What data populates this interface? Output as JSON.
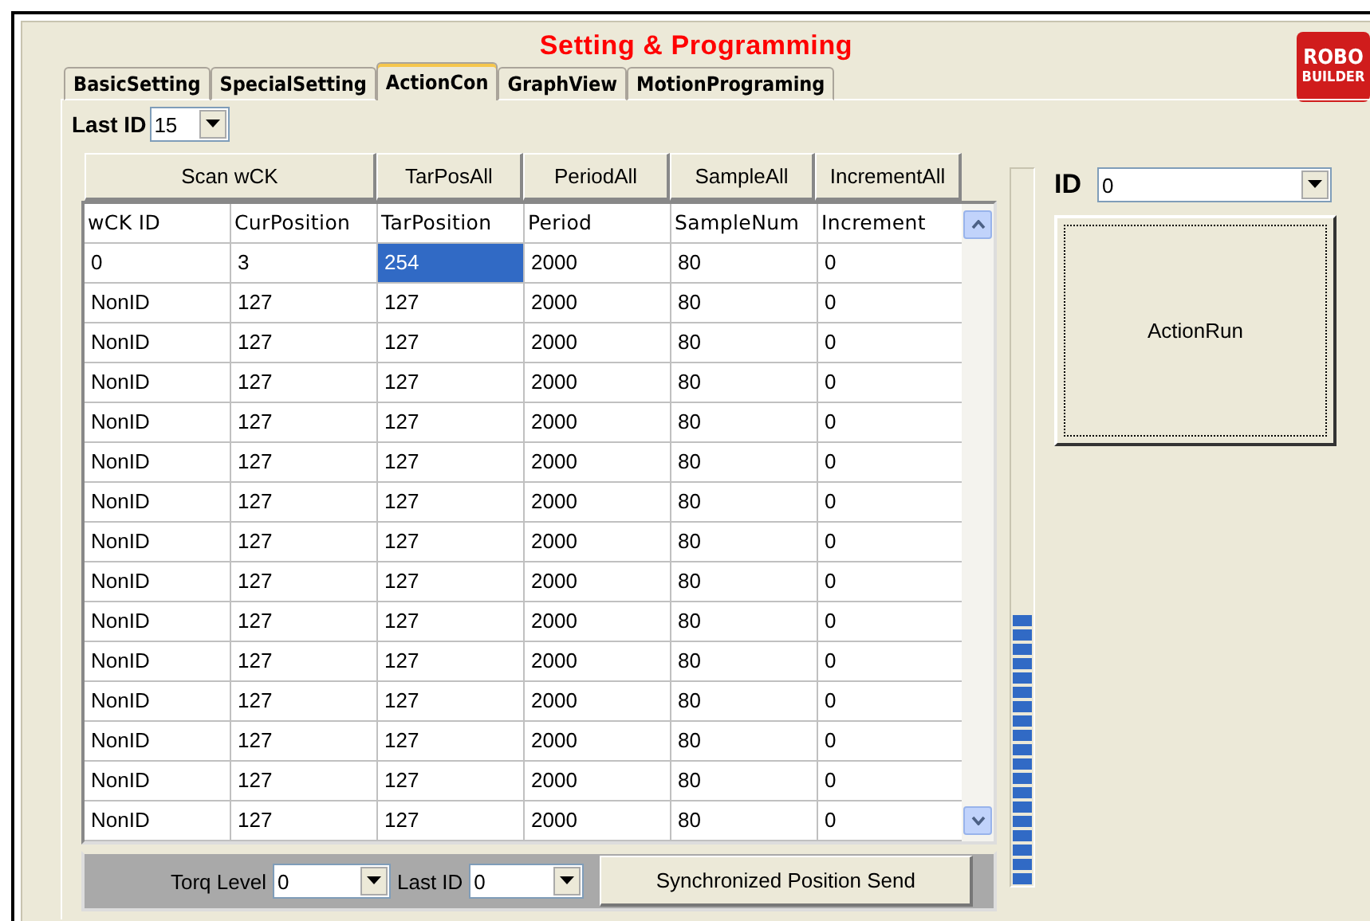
{
  "title": "Setting & Programming",
  "logo": {
    "lines": [
      "ROBO",
      "BUILDER"
    ]
  },
  "tabs": [
    {
      "label": "BasicSetting",
      "selected": false
    },
    {
      "label": "SpecialSetting",
      "selected": false
    },
    {
      "label": "ActionCon",
      "selected": true
    },
    {
      "label": "GraphView",
      "selected": false
    },
    {
      "label": "MotionPrograming",
      "selected": false
    }
  ],
  "last_id": {
    "label": "Last ID",
    "value": "15"
  },
  "action_buttons": [
    "Scan wCK",
    "TarPosAll",
    "PeriodAll",
    "SampleAll",
    "IncrementAll"
  ],
  "table": {
    "columns": [
      "wCK ID",
      "CurPosition",
      "TarPosition",
      "Period",
      "SampleNum",
      "Increment"
    ],
    "rows": [
      [
        {
          "text": "0",
          "selected": false
        },
        {
          "text": "3",
          "selected": false
        },
        {
          "text": "254",
          "selected": true
        },
        {
          "text": "2000",
          "selected": false
        },
        {
          "text": "80",
          "selected": false
        },
        {
          "text": "0",
          "selected": false
        }
      ],
      [
        {
          "text": "NonID",
          "selected": false
        },
        {
          "text": "127",
          "selected": false
        },
        {
          "text": "127",
          "selected": false
        },
        {
          "text": "2000",
          "selected": false
        },
        {
          "text": "80",
          "selected": false
        },
        {
          "text": "0",
          "selected": false
        }
      ],
      [
        {
          "text": "NonID",
          "selected": false
        },
        {
          "text": "127",
          "selected": false
        },
        {
          "text": "127",
          "selected": false
        },
        {
          "text": "2000",
          "selected": false
        },
        {
          "text": "80",
          "selected": false
        },
        {
          "text": "0",
          "selected": false
        }
      ],
      [
        {
          "text": "NonID",
          "selected": false
        },
        {
          "text": "127",
          "selected": false
        },
        {
          "text": "127",
          "selected": false
        },
        {
          "text": "2000",
          "selected": false
        },
        {
          "text": "80",
          "selected": false
        },
        {
          "text": "0",
          "selected": false
        }
      ],
      [
        {
          "text": "NonID",
          "selected": false
        },
        {
          "text": "127",
          "selected": false
        },
        {
          "text": "127",
          "selected": false
        },
        {
          "text": "2000",
          "selected": false
        },
        {
          "text": "80",
          "selected": false
        },
        {
          "text": "0",
          "selected": false
        }
      ],
      [
        {
          "text": "NonID",
          "selected": false
        },
        {
          "text": "127",
          "selected": false
        },
        {
          "text": "127",
          "selected": false
        },
        {
          "text": "2000",
          "selected": false
        },
        {
          "text": "80",
          "selected": false
        },
        {
          "text": "0",
          "selected": false
        }
      ],
      [
        {
          "text": "NonID",
          "selected": false
        },
        {
          "text": "127",
          "selected": false
        },
        {
          "text": "127",
          "selected": false
        },
        {
          "text": "2000",
          "selected": false
        },
        {
          "text": "80",
          "selected": false
        },
        {
          "text": "0",
          "selected": false
        }
      ],
      [
        {
          "text": "NonID",
          "selected": false
        },
        {
          "text": "127",
          "selected": false
        },
        {
          "text": "127",
          "selected": false
        },
        {
          "text": "2000",
          "selected": false
        },
        {
          "text": "80",
          "selected": false
        },
        {
          "text": "0",
          "selected": false
        }
      ],
      [
        {
          "text": "NonID",
          "selected": false
        },
        {
          "text": "127",
          "selected": false
        },
        {
          "text": "127",
          "selected": false
        },
        {
          "text": "2000",
          "selected": false
        },
        {
          "text": "80",
          "selected": false
        },
        {
          "text": "0",
          "selected": false
        }
      ],
      [
        {
          "text": "NonID",
          "selected": false
        },
        {
          "text": "127",
          "selected": false
        },
        {
          "text": "127",
          "selected": false
        },
        {
          "text": "2000",
          "selected": false
        },
        {
          "text": "80",
          "selected": false
        },
        {
          "text": "0",
          "selected": false
        }
      ],
      [
        {
          "text": "NonID",
          "selected": false
        },
        {
          "text": "127",
          "selected": false
        },
        {
          "text": "127",
          "selected": false
        },
        {
          "text": "2000",
          "selected": false
        },
        {
          "text": "80",
          "selected": false
        },
        {
          "text": "0",
          "selected": false
        }
      ],
      [
        {
          "text": "NonID",
          "selected": false
        },
        {
          "text": "127",
          "selected": false
        },
        {
          "text": "127",
          "selected": false
        },
        {
          "text": "2000",
          "selected": false
        },
        {
          "text": "80",
          "selected": false
        },
        {
          "text": "0",
          "selected": false
        }
      ],
      [
        {
          "text": "NonID",
          "selected": false
        },
        {
          "text": "127",
          "selected": false
        },
        {
          "text": "127",
          "selected": false
        },
        {
          "text": "2000",
          "selected": false
        },
        {
          "text": "80",
          "selected": false
        },
        {
          "text": "0",
          "selected": false
        }
      ],
      [
        {
          "text": "NonID",
          "selected": false
        },
        {
          "text": "127",
          "selected": false
        },
        {
          "text": "127",
          "selected": false
        },
        {
          "text": "2000",
          "selected": false
        },
        {
          "text": "80",
          "selected": false
        },
        {
          "text": "0",
          "selected": false
        }
      ],
      [
        {
          "text": "NonID",
          "selected": false
        },
        {
          "text": "127",
          "selected": false
        },
        {
          "text": "127",
          "selected": false
        },
        {
          "text": "2000",
          "selected": false
        },
        {
          "text": "80",
          "selected": false
        },
        {
          "text": "0",
          "selected": false
        }
      ]
    ]
  },
  "bottom_bar": {
    "torq_label": "Torq Level",
    "torq_value": "0",
    "last_id_label": "Last ID",
    "last_id_value": "0",
    "send_button": "Synchronized Position Send"
  },
  "progress": {
    "level": 0.38
  },
  "id_select": {
    "label": "ID",
    "value": "0"
  },
  "action_run": "ActionRun"
}
